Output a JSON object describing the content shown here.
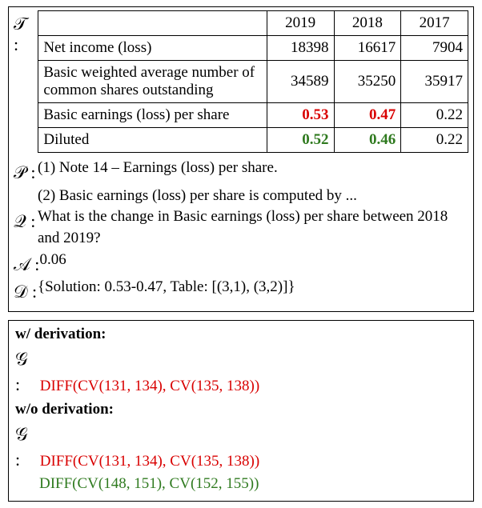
{
  "labels": {
    "T": "𝒯 :",
    "P": "𝒫 :",
    "Q": "𝒬  :",
    "A": "𝒜  :",
    "D": "𝒟  :",
    "G": "𝒢 :"
  },
  "table": {
    "years": [
      "2019",
      "2018",
      "2017"
    ],
    "rows": [
      {
        "label": "Net income (loss)",
        "vals": [
          "18398",
          "16617",
          "7904"
        ]
      },
      {
        "label": "Basic weighted average number of common shares outstanding",
        "vals": [
          "34589",
          "35250",
          "35917"
        ]
      },
      {
        "label": "Basic earnings (loss) per share",
        "vals": [
          "0.53",
          "0.47",
          "0.22"
        ],
        "style": [
          "bold red",
          "bold red",
          ""
        ]
      },
      {
        "label": "Diluted",
        "vals": [
          "0.52",
          "0.46",
          "0.22"
        ],
        "style": [
          "bold green",
          "bold green",
          ""
        ]
      }
    ]
  },
  "P_lines": {
    "l1": "(1) Note 14 – Earnings (loss) per share.",
    "l2": "(2) Basic earnings (loss) per share is computed by ..."
  },
  "Q_text": "What is the change in Basic earnings (loss) per share between 2018 and 2019?",
  "A_text": " 0.06",
  "D_text": "{Solution: 0.53-0.47,   Table:  [(3,1),  (3,2)]}",
  "box2": {
    "with_label": "w/ derivation:",
    "without_label": "w/o derivation:",
    "expr_main": "DIFF(CV(131, 134), CV(135, 138))",
    "expr_alt": "DIFF(CV(148, 151), CV(152, 155))"
  },
  "chart_data": {
    "type": "table",
    "columns": [
      "",
      "2019",
      "2018",
      "2017"
    ],
    "rows": [
      [
        "Net income (loss)",
        18398,
        16617,
        7904
      ],
      [
        "Basic weighted average number of common shares outstanding",
        34589,
        35250,
        35917
      ],
      [
        "Basic earnings (loss) per share",
        0.53,
        0.47,
        0.22
      ],
      [
        "Diluted",
        0.52,
        0.46,
        0.22
      ]
    ],
    "highlighting": {
      "red_bold": [
        [
          2,
          1
        ],
        [
          2,
          2
        ]
      ],
      "green_bold": [
        [
          3,
          1
        ],
        [
          3,
          2
        ]
      ]
    }
  }
}
